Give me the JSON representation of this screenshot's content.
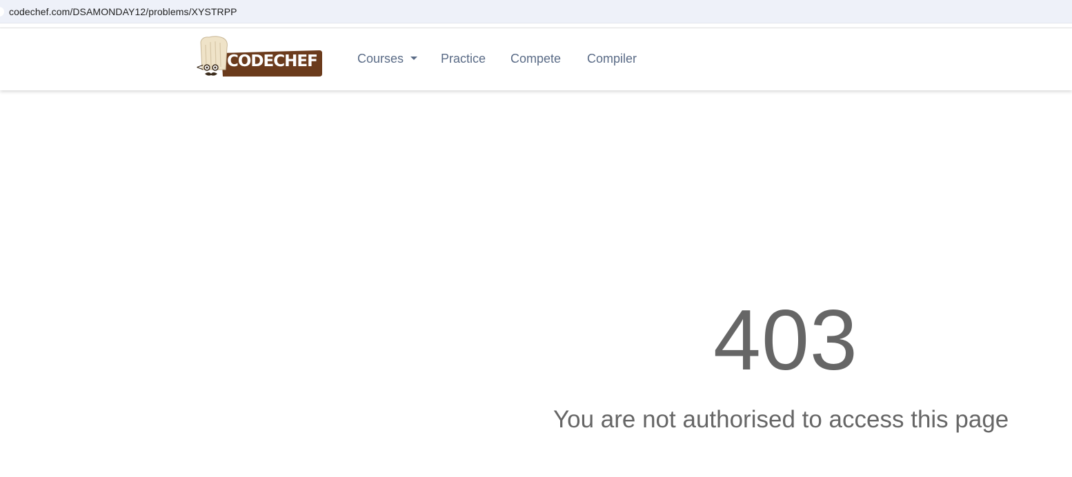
{
  "browser": {
    "url": "codechef.com/DSAMONDAY12/problems/XYSTRPP"
  },
  "header": {
    "logo_text": "CODECHEF",
    "nav": {
      "courses": "Courses",
      "practice": "Practice",
      "compete": "Compete",
      "compiler": "Compiler"
    }
  },
  "error": {
    "code": "403",
    "message": "You are not authorised to access this page"
  },
  "colors": {
    "logo_brown": "#6b3b1c",
    "nav_text": "#5a6b86",
    "error_text": "#666666",
    "urlbar_bg": "#eef1f9"
  },
  "icons": [
    "chef-hat-icon",
    "chevron-down-icon"
  ]
}
